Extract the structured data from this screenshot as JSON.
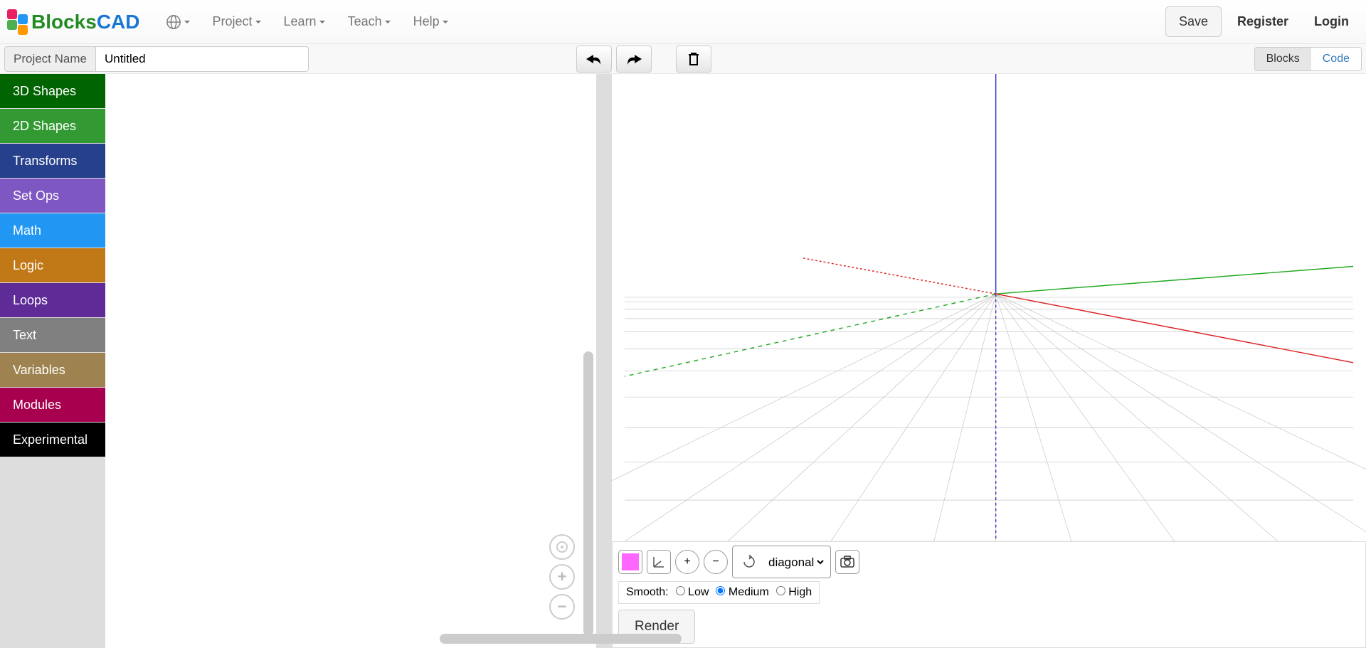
{
  "brand": {
    "blocks": "Blocks",
    "cad": "CAD"
  },
  "nav": {
    "items": [
      "Project",
      "Learn",
      "Teach",
      "Help"
    ],
    "save": "Save",
    "register": "Register",
    "login": "Login"
  },
  "project": {
    "label": "Project Name",
    "value": "Untitled"
  },
  "toggle": {
    "blocks": "Blocks",
    "code": "Code"
  },
  "categories": [
    {
      "label": "3D Shapes",
      "color": "#006400"
    },
    {
      "label": "2D Shapes",
      "color": "#339933"
    },
    {
      "label": "Transforms",
      "color": "#26408B"
    },
    {
      "label": "Set Ops",
      "color": "#7E57C2"
    },
    {
      "label": "Math",
      "color": "#2196F3"
    },
    {
      "label": "Logic",
      "color": "#C17817"
    },
    {
      "label": "Loops",
      "color": "#5E2B97"
    },
    {
      "label": "Text",
      "color": "#808080"
    },
    {
      "label": "Variables",
      "color": "#9E8350"
    },
    {
      "label": "Modules",
      "color": "#A6004F"
    },
    {
      "label": "Experimental",
      "color": "#000000"
    }
  ],
  "viewport": {
    "view_select": "diagonal",
    "smooth": {
      "label": "Smooth:",
      "options": [
        "Low",
        "Medium",
        "High"
      ],
      "selected": "Medium"
    },
    "render": "Render",
    "default_color": "#ff66ff"
  }
}
